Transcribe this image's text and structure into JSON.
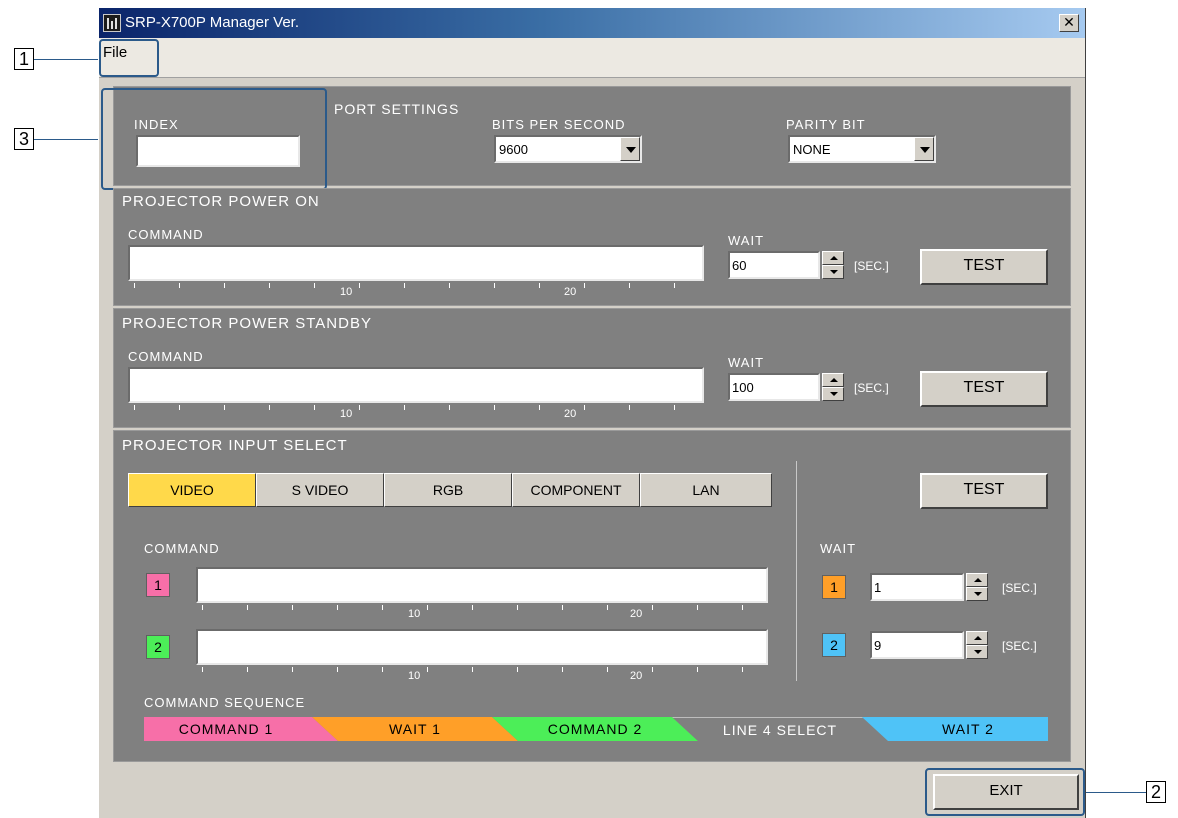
{
  "window": {
    "title": "SRP-X700P Manager Ver.",
    "close_glyph": "✕",
    "menu": {
      "file": "File"
    }
  },
  "port": {
    "index_label": "INDEX",
    "index_value": "",
    "header": "PORT SETTINGS",
    "bps_label": "BITS PER SECOND",
    "bps_value": "9600",
    "parity_label": "PARITY BIT",
    "parity_value": "NONE"
  },
  "power_on": {
    "header": "PROJECTOR POWER ON",
    "command_label": "COMMAND",
    "command_value": "",
    "wait_label": "WAIT",
    "wait_value": "60",
    "unit": "[SEC.]",
    "test_label": "TEST",
    "ruler": [
      "10",
      "20"
    ]
  },
  "power_standby": {
    "header": "PROJECTOR POWER STANDBY",
    "command_label": "COMMAND",
    "command_value": "",
    "wait_label": "WAIT",
    "wait_value": "100",
    "unit": "[SEC.]",
    "test_label": "TEST",
    "ruler": [
      "10",
      "20"
    ]
  },
  "input_select": {
    "header": "PROJECTOR INPUT SELECT",
    "tabs": [
      "VIDEO",
      "S VIDEO",
      "RGB",
      "COMPONENT",
      "LAN"
    ],
    "active_tab": "VIDEO",
    "test_label": "TEST",
    "command_label": "COMMAND",
    "wait_label": "WAIT",
    "command_1_num": "1",
    "command_2_num": "2",
    "command_1_value": "",
    "command_2_value": "",
    "wait_1_num": "1",
    "wait_2_num": "2",
    "wait_1_value": "1",
    "wait_2_value": "9",
    "unit": "[SEC.]",
    "ruler": [
      "10",
      "20"
    ],
    "sequence_label": "COMMAND SEQUENCE",
    "sequence": [
      "COMMAND 1",
      "WAIT 1",
      "COMMAND 2",
      "LINE 4 SELECT",
      "WAIT 2"
    ]
  },
  "exit_label": "EXIT",
  "callouts": [
    "1",
    "2",
    "3"
  ],
  "colors": {
    "pink": "#f76fa8",
    "orange": "#ff9f28",
    "green": "#4cee58",
    "blue": "#4fc3f7",
    "yellow": "#ffd94a",
    "panel": "#808080",
    "window": "#d4d0c8"
  }
}
